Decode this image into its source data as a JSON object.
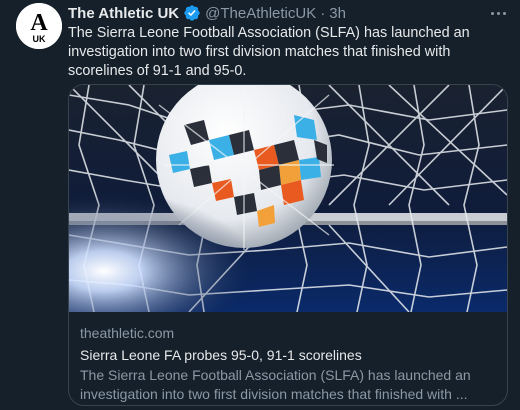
{
  "tweet": {
    "author_name": "The Athletic UK",
    "handle": "@TheAthleticUK",
    "separator": "·",
    "time": "3h",
    "avatar_icon": "the-athletic-logo",
    "avatar_letter": "A",
    "avatar_subtext": "UK",
    "text": "The Sierra Leone Football Association (SLFA) has launched an investigation into two first division matches that finished with scorelines of 91-1 and 95-0."
  },
  "card": {
    "image_icon": "football-in-net-photo",
    "domain": "theathletic.com",
    "title": "Sierra Leone FA probes 95-0, 91-1 scorelines",
    "description_line1": "The Sierra Leone Football Association (SLFA) has launched an",
    "description_line2": "investigation into two first division matches that finished with ..."
  },
  "colors": {
    "background": "#15202b",
    "text": "#e7e9ea",
    "muted": "#8b98a5",
    "verified": "#1d9bf0",
    "border": "#38444d"
  }
}
